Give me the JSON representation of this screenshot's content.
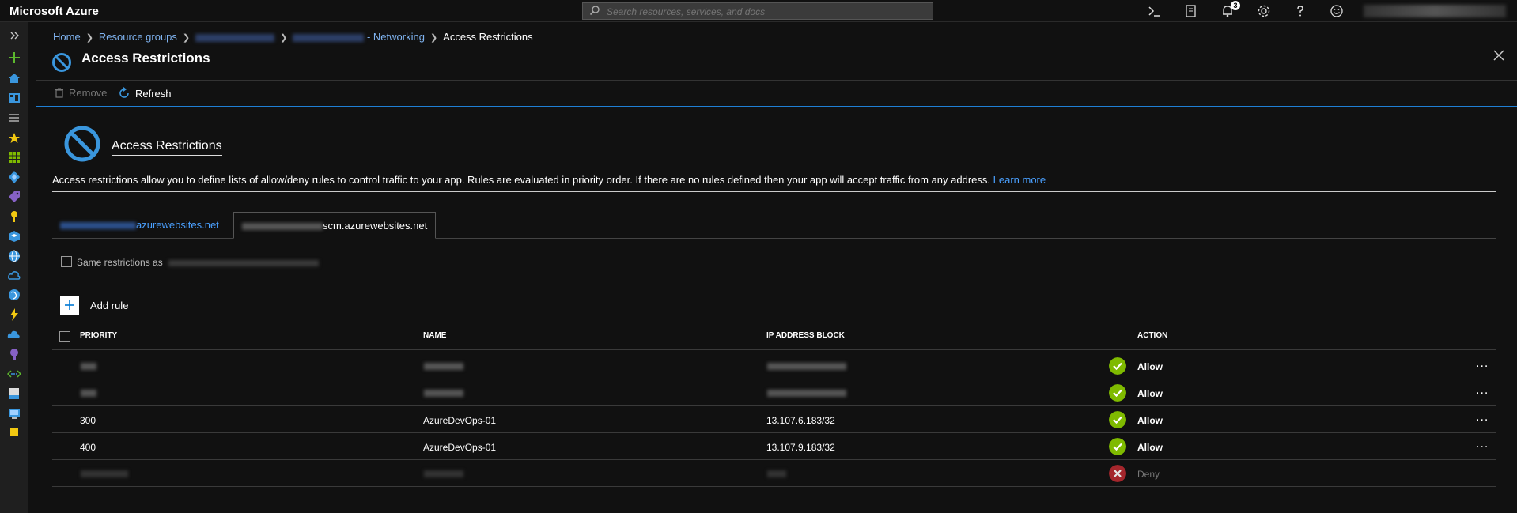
{
  "app": {
    "brand": "Microsoft Azure",
    "search_placeholder": "Search resources, services, and docs",
    "notification_count": "3"
  },
  "breadcrumb": {
    "home": "Home",
    "resource_groups": "Resource groups",
    "networking_suffix": "- Networking",
    "current": "Access Restrictions"
  },
  "blade": {
    "title": "Access Restrictions"
  },
  "toolbar": {
    "remove": "Remove",
    "refresh": "Refresh"
  },
  "content": {
    "heading": "Access Restrictions",
    "description": "Access restrictions allow you to define lists of allow/deny rules to control traffic to your app. Rules are evaluated in priority order. If there are no rules defined then your app will accept traffic from any address.",
    "learn_more": "Learn more"
  },
  "tabs": [
    {
      "label": "azurewebsites.net"
    },
    {
      "label": "scm.azurewebsites.net"
    }
  ],
  "same_restrictions_label": "Same restrictions as",
  "add_rule": "Add rule",
  "table": {
    "headers": {
      "priority": "PRIORITY",
      "name": "NAME",
      "ip": "IP ADDRESS BLOCK",
      "action": "ACTION"
    },
    "rows": [
      {
        "priority": "",
        "name": "",
        "ip": "",
        "action": "Allow",
        "status": "allow"
      },
      {
        "priority": "",
        "name": "",
        "ip": "",
        "action": "Allow",
        "status": "allow"
      },
      {
        "priority": "300",
        "name": "AzureDevOps-01",
        "ip": "13.107.6.183/32",
        "action": "Allow",
        "status": "allow"
      },
      {
        "priority": "400",
        "name": "AzureDevOps-01",
        "ip": "13.107.9.183/32",
        "action": "Allow",
        "status": "allow"
      },
      {
        "priority": "",
        "name": "",
        "ip": "",
        "action": "Deny",
        "status": "deny"
      }
    ],
    "more_label": "..."
  },
  "colors": {
    "allow": "#7fba00",
    "deny": "#a4262c",
    "link": "#4aa0ff",
    "accent": "#1f7fd4"
  }
}
